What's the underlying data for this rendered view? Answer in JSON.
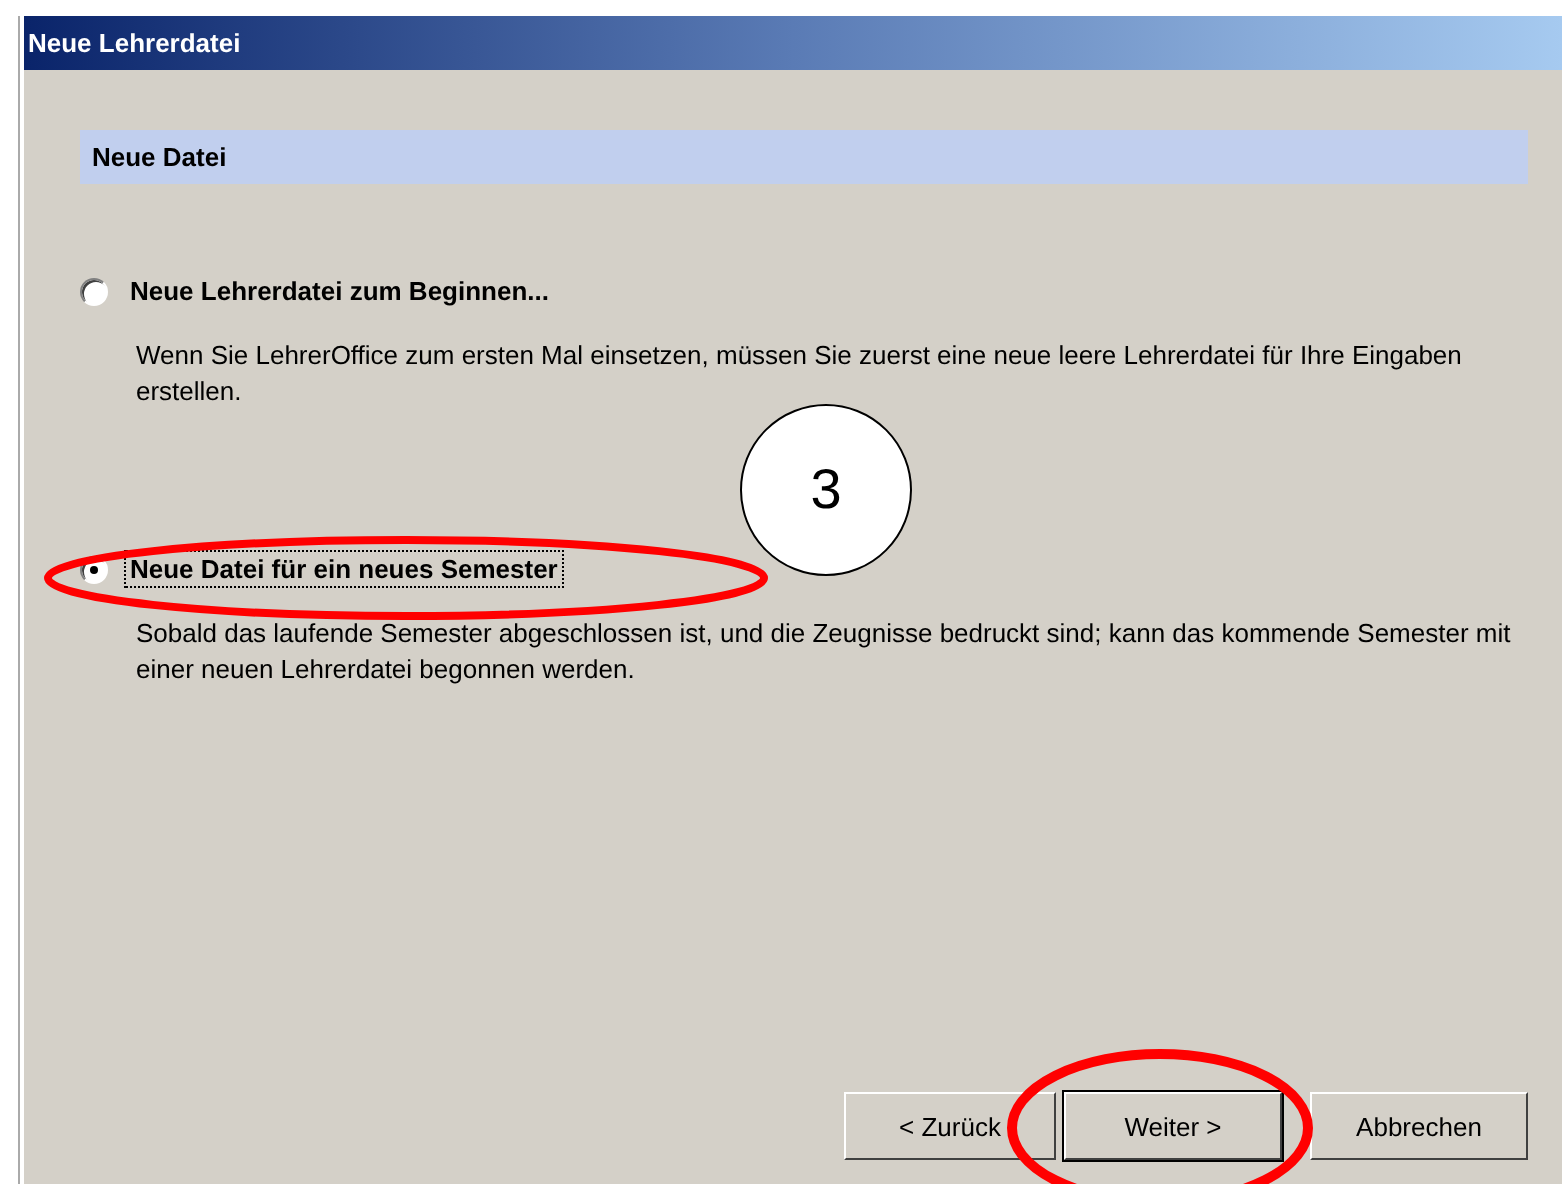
{
  "window": {
    "title": "Neue Lehrerdatei"
  },
  "header": "Neue Datei",
  "options": [
    {
      "label": "Neue Lehrerdatei zum Beginnen...",
      "description": "Wenn Sie LehrerOffice zum ersten Mal einsetzen, müssen Sie zuerst eine neue leere Lehrerdatei für Ihre Eingaben erstellen.",
      "selected": false,
      "circled": false
    },
    {
      "label": "Neue Datei für ein neues Semester",
      "description": "Sobald das laufende Semester abgeschlossen ist, und die Zeugnisse bedruckt sind; kann das kommende Semester mit einer neuen Lehrerdatei begonnen werden.",
      "selected": true,
      "circled": true
    }
  ],
  "step_marker": "3",
  "buttons": [
    {
      "label": "< Zurück",
      "default": false,
      "circled": false
    },
    {
      "label": "Weiter >",
      "default": true,
      "circled": true
    },
    {
      "label": "Abbrechen",
      "default": false,
      "circled": false
    }
  ]
}
